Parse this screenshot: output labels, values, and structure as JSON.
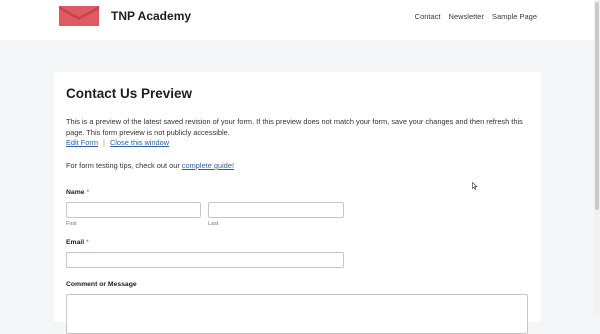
{
  "header": {
    "site_title": "TNP Academy",
    "logo_icon": "envelope-logo-icon",
    "logo_color": "#e05a62",
    "nav": [
      {
        "label": "Contact"
      },
      {
        "label": "Newsletter"
      },
      {
        "label": "Sample Page"
      }
    ]
  },
  "preview": {
    "title": "Contact Us Preview",
    "intro": "This is a preview of the latest saved revision of your form. If this preview does not match your form, save your changes and then refresh this page. This form preview is not publicly accessible.",
    "edit_link": "Edit Form",
    "separator": "|",
    "close_link": "Close this window",
    "tips_text": "For form testing tips, check out our ",
    "tips_link": "complete guide!"
  },
  "form": {
    "name_label": "Name",
    "required_mark": "*",
    "first_sublabel": "First",
    "last_sublabel": "Last",
    "first_value": "",
    "last_value": "",
    "email_label": "Email",
    "email_value": "",
    "comment_label": "Comment or Message",
    "comment_value": ""
  },
  "colors": {
    "page_background": "#f5f6f8",
    "link": "#2b5fa8",
    "required": "#c0392b"
  }
}
